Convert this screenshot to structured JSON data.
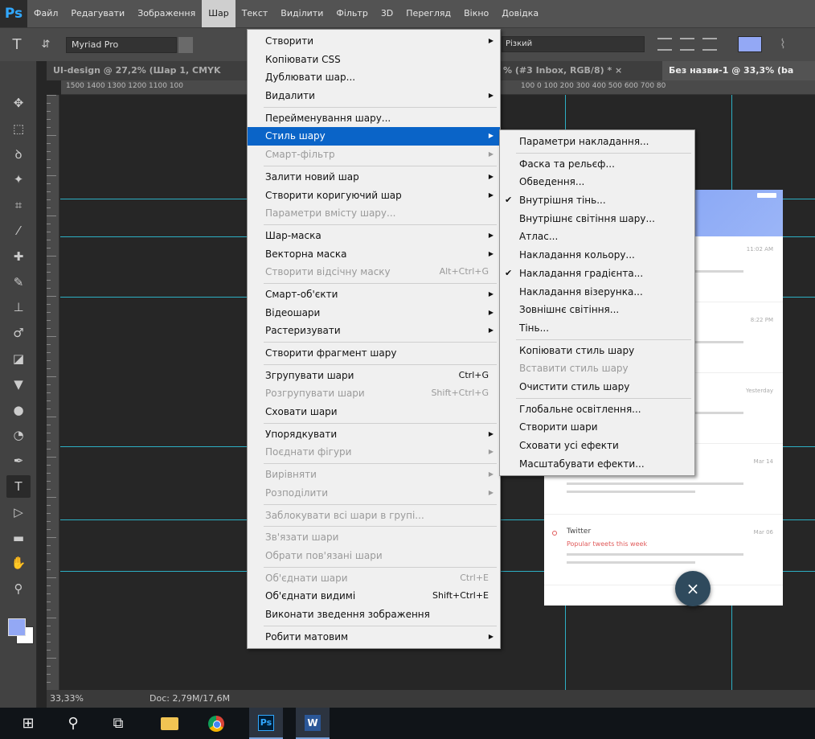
{
  "app": {
    "logo": "Ps"
  },
  "menubar": {
    "items": [
      "Файл",
      "Редагувати",
      "Зображення",
      "Шар",
      "Текст",
      "Виділити",
      "Фільтр",
      "3D",
      "Перегляд",
      "Вікно",
      "Довідка"
    ],
    "active_index": 3
  },
  "options": {
    "tool_icon": "T",
    "font_family": "Myriad Pro",
    "antialias": "Різкий",
    "text_color": "#93a8f5"
  },
  "tabs": [
    {
      "label": "UI-design @ 27,2% (Шар 1, CMYK",
      "active": false
    },
    {
      "label": "% (#3 Inbox, RGB/8) * ×",
      "active": false
    },
    {
      "label": "Без назви-1 @ 33,3% (ba",
      "active": true
    }
  ],
  "ruler": {
    "left_numbers": "1500 1400 1300 1200 1100 100",
    "right_numbers": "100  0  100  200  300  400  500  600  700  80"
  },
  "toolbar": {
    "tools": [
      {
        "name": "move-tool-icon",
        "glyph": "✥"
      },
      {
        "name": "marquee-tool-icon",
        "glyph": "⬚"
      },
      {
        "name": "lasso-tool-icon",
        "glyph": "ꝺ"
      },
      {
        "name": "magic-wand-tool-icon",
        "glyph": "✦"
      },
      {
        "name": "crop-tool-icon",
        "glyph": "⌗"
      },
      {
        "name": "eyedropper-tool-icon",
        "glyph": "⁄"
      },
      {
        "name": "healing-brush-tool-icon",
        "glyph": "✚"
      },
      {
        "name": "brush-tool-icon",
        "glyph": "✎"
      },
      {
        "name": "stamp-tool-icon",
        "glyph": "⊥"
      },
      {
        "name": "history-brush-tool-icon",
        "glyph": "♂"
      },
      {
        "name": "eraser-tool-icon",
        "glyph": "◪"
      },
      {
        "name": "paint-bucket-tool-icon",
        "glyph": "▼"
      },
      {
        "name": "blur-tool-icon",
        "glyph": "●"
      },
      {
        "name": "dodge-tool-icon",
        "glyph": "◔"
      },
      {
        "name": "pen-tool-icon",
        "glyph": "✒"
      },
      {
        "name": "type-tool-icon",
        "glyph": "T"
      },
      {
        "name": "path-selection-tool-icon",
        "glyph": "▷"
      },
      {
        "name": "rectangle-tool-icon",
        "glyph": "▬"
      },
      {
        "name": "hand-tool-icon",
        "glyph": "✋"
      },
      {
        "name": "zoom-tool-icon",
        "glyph": "⚲"
      }
    ],
    "selected_index": 15,
    "foreground_color": "#93a8f5",
    "background_color": "#ffffff"
  },
  "status": {
    "zoom": "33,33%",
    "doc": "Doc: 2,79M/17,6M"
  },
  "layer_menu": {
    "items": [
      {
        "label": "Створити",
        "arrow": true
      },
      {
        "label": "Копіювати CSS"
      },
      {
        "label": "Дублювати шар..."
      },
      {
        "label": "Видалити",
        "arrow": true
      },
      {
        "sep": true
      },
      {
        "label": "Перейменування шару..."
      },
      {
        "label": "Стиль шару",
        "arrow": true,
        "highlight": true
      },
      {
        "label": "Смарт-фільтр",
        "arrow": true,
        "disabled": true
      },
      {
        "sep": true
      },
      {
        "label": "Залити новий шар",
        "arrow": true
      },
      {
        "label": "Створити коригуючий шар",
        "arrow": true
      },
      {
        "label": "Параметри вмісту шару...",
        "disabled": true
      },
      {
        "sep": true
      },
      {
        "label": "Шар-маска",
        "arrow": true
      },
      {
        "label": "Векторна маска",
        "arrow": true
      },
      {
        "label": "Створити відсічну маску",
        "shortcut": "Alt+Ctrl+G",
        "disabled": true
      },
      {
        "sep": true
      },
      {
        "label": "Смарт-об'єкти",
        "arrow": true
      },
      {
        "label": "Відеошари",
        "arrow": true
      },
      {
        "label": "Растеризувати",
        "arrow": true
      },
      {
        "sep": true
      },
      {
        "label": "Створити фрагмент шару"
      },
      {
        "sep": true
      },
      {
        "label": "Згрупувати шари",
        "shortcut": "Ctrl+G"
      },
      {
        "label": "Розгрупувати шари",
        "shortcut": "Shift+Ctrl+G",
        "disabled": true
      },
      {
        "label": "Сховати шари"
      },
      {
        "sep": true
      },
      {
        "label": "Упорядкувати",
        "arrow": true
      },
      {
        "label": "Поєднати фігури",
        "arrow": true,
        "disabled": true
      },
      {
        "sep": true
      },
      {
        "label": "Вирівняти",
        "arrow": true,
        "disabled": true
      },
      {
        "label": "Розподілити",
        "arrow": true,
        "disabled": true
      },
      {
        "sep": true
      },
      {
        "label": "Заблокувати всі шари в групі...",
        "disabled": true
      },
      {
        "sep": true
      },
      {
        "label": "Зв'язати шари",
        "disabled": true
      },
      {
        "label": "Обрати пов'язані шари",
        "disabled": true
      },
      {
        "sep": true
      },
      {
        "label": "Об'єднати шари",
        "shortcut": "Ctrl+E",
        "disabled": true
      },
      {
        "label": "Об'єднати видимі",
        "shortcut": "Shift+Ctrl+E"
      },
      {
        "label": "Виконати зведення зображення"
      },
      {
        "sep": true
      },
      {
        "label": "Робити матовим",
        "arrow": true
      }
    ]
  },
  "style_menu": {
    "items": [
      {
        "label": "Параметри накладання..."
      },
      {
        "sep": true
      },
      {
        "label": "Фаска та рельєф..."
      },
      {
        "label": "Обведення..."
      },
      {
        "label": "Внутрішня тінь...",
        "checked": true
      },
      {
        "label": "Внутрішнє світіння шару..."
      },
      {
        "label": "Атлас..."
      },
      {
        "label": "Накладання кольору..."
      },
      {
        "label": "Накладання градієнта...",
        "checked": true
      },
      {
        "label": "Накладання візерунка..."
      },
      {
        "label": "Зовнішнє світіння..."
      },
      {
        "label": "Тінь..."
      },
      {
        "sep": true
      },
      {
        "label": "Копіювати стиль шару"
      },
      {
        "label": "Вставити стиль шару",
        "disabled": true
      },
      {
        "label": "Очистити стиль шару"
      },
      {
        "sep": true
      },
      {
        "label": "Глобальне освітлення..."
      },
      {
        "label": "Створити шари"
      },
      {
        "label": "Сховати усі ефекти"
      },
      {
        "label": "Масштабувати ефекти..."
      }
    ]
  },
  "artboard": {
    "mails": [
      {
        "time": "11:02 AM",
        "sender": "",
        "subject": ""
      },
      {
        "time": "8:22 PM",
        "sender": "",
        "subject": ""
      },
      {
        "time": "Yesterday",
        "sender": "",
        "subject": ""
      },
      {
        "time": "Mar 14",
        "sender": "",
        "subject": ""
      },
      {
        "time": "Mar 06",
        "sender": "Twitter",
        "subject": "Popular tweets this week"
      }
    ],
    "fab_label": "×"
  }
}
